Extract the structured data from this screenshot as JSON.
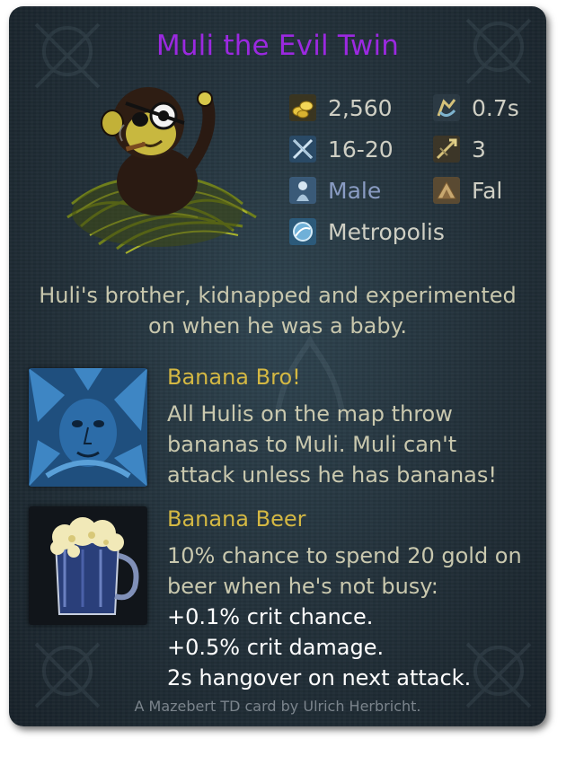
{
  "card": {
    "title": "Muli the Evil Twin",
    "colors": {
      "title": "#9b29e0",
      "ability_title": "#d4b843",
      "body_text": "#c9c8ae",
      "gender_text": "#8a9cc3",
      "bonus_text": "#ffffff"
    }
  },
  "stats": {
    "cost": {
      "icon": "gold-coins-icon",
      "value": "2,560"
    },
    "attack_speed": {
      "icon": "attack-speed-icon",
      "value": "0.7s"
    },
    "damage": {
      "icon": "crossed-swords-icon",
      "value": "16-20"
    },
    "range": {
      "icon": "range-icon",
      "value": "3"
    },
    "gender": {
      "icon": "gender-icon",
      "value": "Male"
    },
    "family": {
      "icon": "family-icon",
      "value": "Fal"
    },
    "origin": {
      "icon": "origin-icon",
      "value": "Metropolis"
    }
  },
  "description": "Huli's brother, kidnapped and experimented on when he was a baby.",
  "abilities": [
    {
      "icon": "blue-face-in-leaves-icon",
      "title": "Banana Bro!",
      "text": "All Hulis on the map throw bananas to Muli. Muli can't attack unless he has bananas!"
    },
    {
      "icon": "beer-mug-icon",
      "title": "Banana Beer",
      "text": "10% chance to spend 20 gold on beer when he's not busy:",
      "bonuses": [
        "+0.1% crit chance.",
        "+0.5% crit damage.",
        "2s hangover on next attack."
      ]
    }
  ],
  "credit": "A Mazebert TD card by Ulrich Herbricht."
}
